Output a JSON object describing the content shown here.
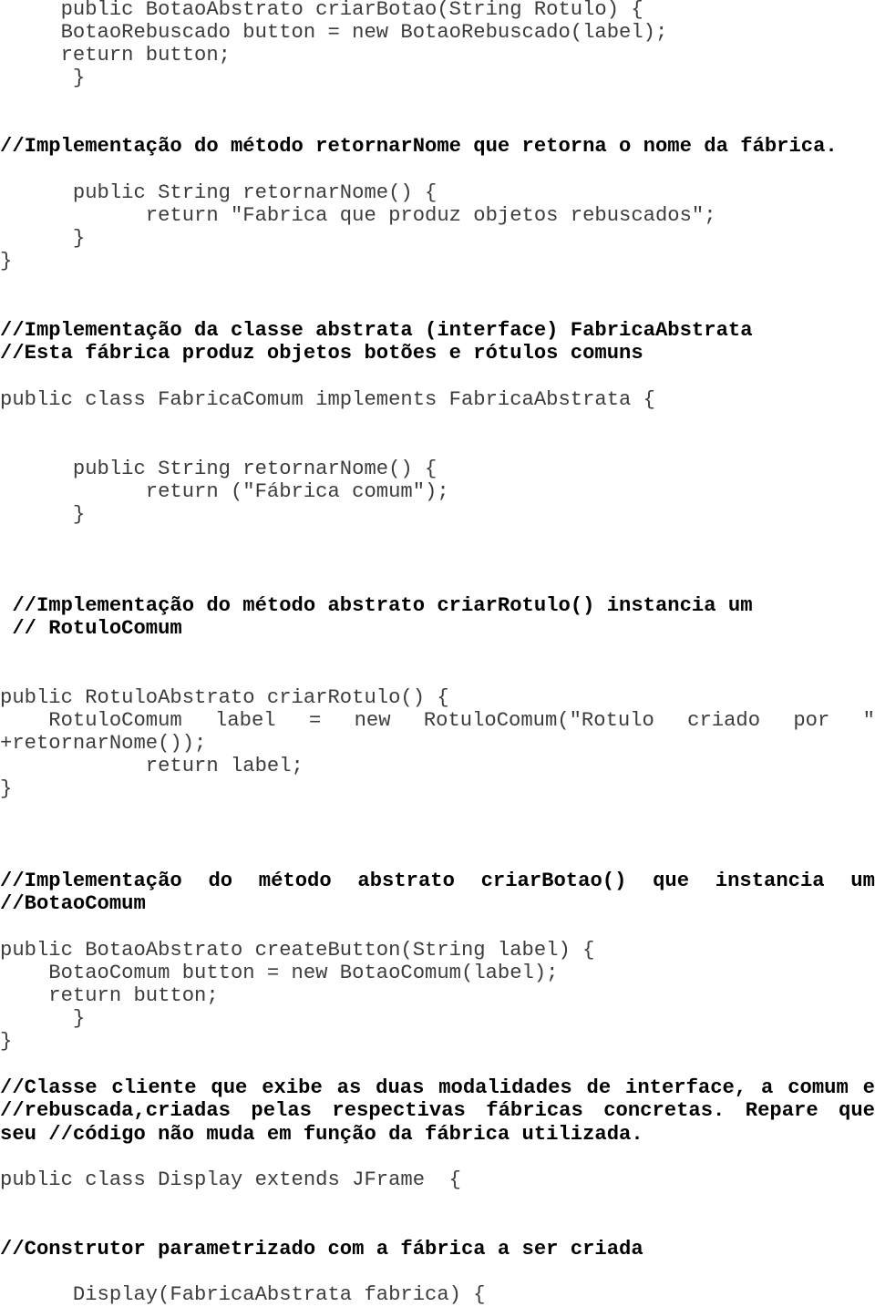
{
  "document": {
    "lines": {
      "l01": "     public BotaoAbstrato criarBotao(String Rotulo) {",
      "l02": "     BotaoRebuscado button = new BotaoRebuscado(label);",
      "l03": "     return button;",
      "l04": "      }",
      "l05": "//Implementação do método retornarNome que retorna o nome da fábrica.",
      "l06": "      public String retornarNome() {",
      "l07": "            return \"Fabrica que produz objetos rebuscados\";",
      "l08": "      }",
      "l09": "}",
      "l10": "//Implementação da classe abstrata (interface) FabricaAbstrata",
      "l11": "//Esta fábrica produz objetos botões e rótulos comuns",
      "l12": "public class FabricaComum implements FabricaAbstrata {",
      "l13": "      public String retornarNome() {",
      "l14": "            return (\"Fábrica comum\");",
      "l15": "      }",
      "l16": " //Implementação do método abstrato criarRotulo() instancia um",
      "l17": " // RotuloComum",
      "l18": "public RotuloAbstrato criarRotulo() {",
      "l19_words": [
        "    RotuloComum",
        "label",
        "=",
        "new",
        "RotuloComum(\"Rotulo",
        "criado",
        "por",
        "\""
      ],
      "l20": "+retornarNome());",
      "l21": "            return label;",
      "l22": "}",
      "l23_words": [
        "//Implementação",
        "do",
        "método",
        "abstrato",
        "criarBotao()",
        "que",
        "instancia",
        "um"
      ],
      "l24": "//BotaoComum",
      "l25": "public BotaoAbstrato createButton(String label) {",
      "l26": "    BotaoComum button = new BotaoComum(label);",
      "l27": "    return button;",
      "l28": "      }",
      "l29": "}",
      "l30_words": [
        "//Classe",
        "cliente",
        "que",
        "exibe",
        "as",
        "duas",
        "modalidades",
        "de",
        "interface,",
        "a",
        "comum",
        "e"
      ],
      "l31_words": [
        "//rebuscada,criadas",
        "pelas",
        "respectivas",
        "fábricas",
        "concretas.",
        "Repare",
        "que"
      ],
      "l32": "seu //código não muda em função da fábrica utilizada.",
      "l33": "public class Display extends JFrame  {",
      "l34": "//Construtor parametrizado com a fábrica a ser criada",
      "l35": "      Display(FabricaAbstrata fabrica) {"
    }
  }
}
